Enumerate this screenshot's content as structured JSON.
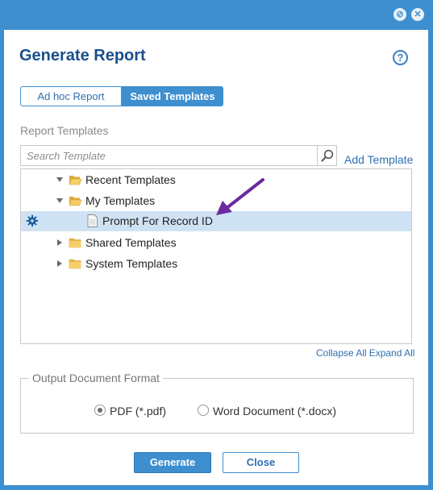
{
  "window": {
    "title": "Generate Report",
    "help_glyph": "?"
  },
  "toggle": {
    "adhoc_label": "Ad hoc Report",
    "saved_label": "Saved Templates",
    "active": "Saved Templates"
  },
  "templates": {
    "section_label": "Report Templates",
    "search_placeholder": "Search Template",
    "add_label": "Add Template",
    "tree": [
      {
        "label": "Recent Templates",
        "type": "folder",
        "expanded": true,
        "icon": "folder-open-icon"
      },
      {
        "label": "My Templates",
        "type": "folder",
        "expanded": true,
        "icon": "folder-open-icon"
      },
      {
        "label": "Prompt For Record ID",
        "type": "template",
        "selected": true,
        "icon": "document-icon"
      },
      {
        "label": "Shared Templates",
        "type": "folder",
        "expanded": false,
        "icon": "folder-icon"
      },
      {
        "label": "System Templates",
        "type": "folder",
        "expanded": false,
        "icon": "folder-icon"
      }
    ],
    "collapse_all": "Collapse All",
    "expand_all": "Expand All"
  },
  "output": {
    "legend": "Output Document Format",
    "options": [
      "PDF (*.pdf)",
      "Word Document (*.docx)"
    ],
    "selected": "PDF (*.pdf)"
  },
  "actions": {
    "generate_label": "Generate",
    "close_label": "Close"
  },
  "colors": {
    "frame": "#3d8fcf",
    "title": "#1a4f8a",
    "link": "#2f6fb1",
    "selected_row": "#cfe2f3",
    "annotation_arrow": "#6b2a9e"
  }
}
